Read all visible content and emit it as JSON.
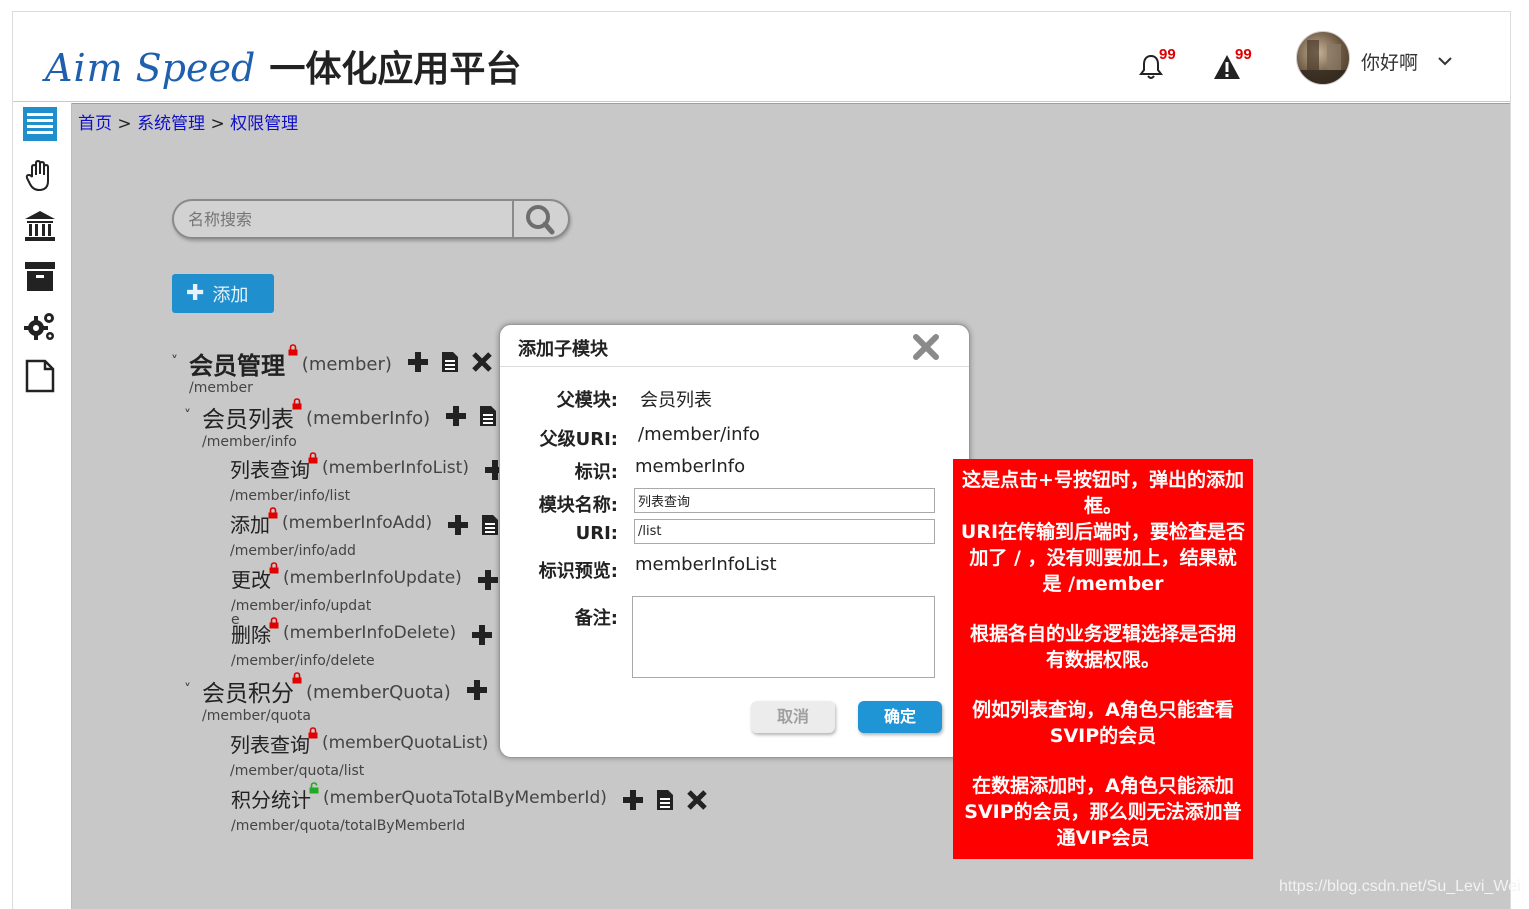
{
  "header": {
    "logo_aim": "Aim",
    "logo_speed": "Speed",
    "logo_subtitle": "一体化应用平台",
    "bell_badge": "99",
    "alert_badge": "99",
    "username": "你好啊"
  },
  "breadcrumb": {
    "home": "首页",
    "sep1": " > ",
    "system": "系统管理",
    "sep2": " > ",
    "permission": "权限管理"
  },
  "search": {
    "placeholder": "名称搜索"
  },
  "toolbar": {
    "add_label": "添加"
  },
  "tree": [
    {
      "name": "会员管理",
      "code": "(member)",
      "uri": "/member",
      "lock": "locked"
    },
    {
      "name": "会员列表",
      "code": "(memberInfo)",
      "uri": "/member/info",
      "lock": "locked"
    },
    {
      "name": "列表查询",
      "code": "(memberInfoList)",
      "uri": "/member/info/list",
      "lock": "locked"
    },
    {
      "name": "添加",
      "code": "(memberInfoAdd)",
      "uri": "/member/info/add",
      "lock": "locked"
    },
    {
      "name": "更改",
      "code": "(memberInfoUpdate)",
      "uri": "/member/info/updat",
      "uri_wrap": "e",
      "lock": "locked"
    },
    {
      "name": "删除",
      "code": "(memberInfoDelete)",
      "uri": "/member/info/delete",
      "lock": "locked"
    },
    {
      "name": "会员积分",
      "code": "(memberQuota)",
      "uri": "/member/quota",
      "lock": "locked"
    },
    {
      "name": "列表查询",
      "code": "(memberQuotaList)",
      "uri": "/member/quota/list",
      "lock": "locked"
    },
    {
      "name": "积分统计",
      "code": "(memberQuotaTotalByMemberId)",
      "uri": "/member/quota/totalByMemberId",
      "lock": "unlocked"
    }
  ],
  "dialog": {
    "title": "添加子模块",
    "parent_module_label": "父模块:",
    "parent_module_value": "会员列表",
    "parent_uri_label": "父级URI:",
    "parent_uri_value": "/member/info",
    "identifier_label": "标识:",
    "identifier_value": "memberInfo",
    "module_name_label": "模块名称:",
    "module_name_value": "列表查询",
    "uri_label": "URI:",
    "uri_value": "/list",
    "identifier_preview_label": "标识预览:",
    "identifier_preview_value": "memberInfoList",
    "remark_label": "备注:",
    "remark_value": "",
    "cancel_label": "取消",
    "ok_label": "确定"
  },
  "note": {
    "lines1": [
      "这是点击+号按钮时，弹出的添加",
      "框。",
      "URI在传输到后端时，要检查是否",
      "加了 / ，没有则要加上，结果就",
      "是 /member"
    ],
    "lines2": [
      "根据各自的业务逻辑选择是否拥",
      "有数据权限。"
    ],
    "lines3": [
      "例如列表查询，A角色只能查看",
      "SVIP的会员"
    ],
    "lines4": [
      "在数据添加时，A角色只能添加",
      "SVIP的会员，那么则无法添加普",
      "通VIP会员"
    ]
  },
  "watermark": "https://blog.csdn.net/Su_Levi_Wei",
  "colors": {
    "accent": "#1f8fce",
    "note_bg": "#ff0000",
    "lock_locked": "#e00000",
    "lock_unlocked": "#22aa22",
    "main_bg": "#c8c8c8"
  }
}
